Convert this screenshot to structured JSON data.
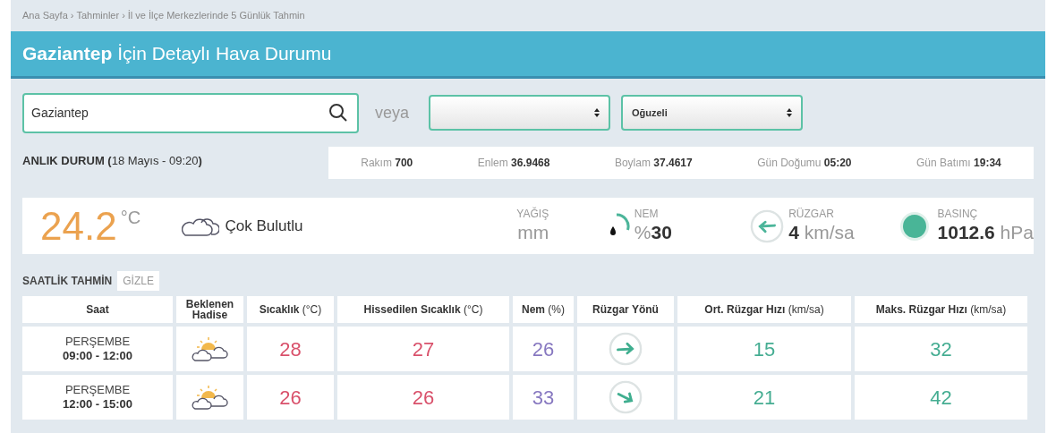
{
  "breadcrumb": {
    "separator": "›",
    "items": [
      "Ana Sayfa",
      "Tahminler",
      "İl ve İlçe Merkezlerinde 5 Günlük Tahmin"
    ]
  },
  "header": {
    "city": "Gaziantep",
    "title": "İçin Detaylı Hava Durumu"
  },
  "search": {
    "value": "Gaziantep"
  },
  "or_label": "veya",
  "selects": [
    {
      "kind": "empty"
    },
    {
      "kind": "filled",
      "value": "Oğuzeli"
    }
  ],
  "now": {
    "label": "ANLIK DURUM",
    "date": "**(**18 Mayıs - 09:20**)**"
  },
  "info": [
    {
      "label": "Rakım",
      "value": "700"
    },
    {
      "label": "Enlem",
      "value": "36.9468"
    },
    {
      "label": "Boylam",
      "value": "37.4617"
    },
    {
      "label": "Gün Doğumu",
      "value": "05:20"
    },
    {
      "label": "Gün Batımı",
      "value": "19:34"
    }
  ],
  "current": {
    "temperature": "24.2",
    "unit": "°C",
    "condition": "Çok Bulutlu",
    "metrics": [
      {
        "kind": "precip",
        "label": "YAĞIŞ",
        "unit": "mm"
      },
      {
        "kind": "humidity",
        "label": "NEM",
        "prefix": "%",
        "value": "30"
      },
      {
        "kind": "wind",
        "label": "RÜZGAR",
        "value": "4",
        "unit": "km/sa"
      },
      {
        "kind": "pressure",
        "label": "BASINÇ",
        "value": "1012.6",
        "unit": "hPa"
      }
    ]
  },
  "hourly": {
    "title": "SAATLİK TAHMİN",
    "toggle": "GİZLE",
    "columns": [
      "**Saat**",
      "**Beklenen Hadise**",
      "**Sıcaklık** (°C)",
      "**Hissedilen Sıcaklık** (°C)",
      "**Nem** (%)",
      "**Rüzgar Yönü**",
      "**Ort. Rüzgar Hızı** (km/sa)",
      "**Maks. Rüzgar Hızı** (km/sa)"
    ],
    "rows": [
      {
        "day": "PERŞEMBE",
        "time": "09:00 - 12:00",
        "temperature": "28",
        "feels_like": "27",
        "humidity": "26",
        "avg_wind": "15",
        "max_wind": "32"
      },
      {
        "day": "PERŞEMBE",
        "time": "12:00 - 15:00",
        "temperature": "26",
        "feels_like": "26",
        "humidity": "33",
        "avg_wind": "21",
        "max_wind": "42"
      }
    ]
  }
}
